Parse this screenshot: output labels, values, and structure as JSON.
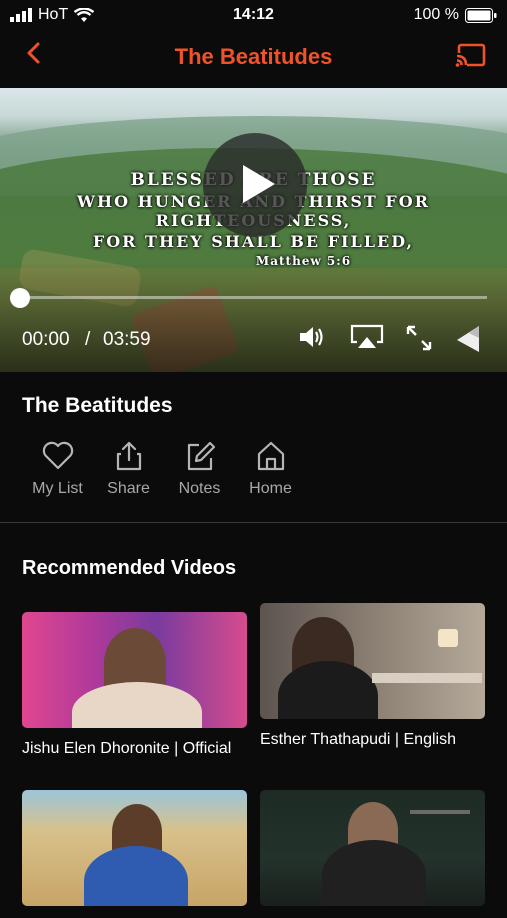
{
  "status_bar": {
    "carrier": "HoT",
    "time": "14:12",
    "battery": "100 %"
  },
  "nav": {
    "title": "The Beatitudes",
    "back_icon": "chevron-left-icon",
    "cast_icon": "cast-icon"
  },
  "player": {
    "overlay": {
      "line1": "BLESSED ARE THOSE",
      "line2": "WHO HUNGER AND THIRST FOR RIGHTEOUSNESS,",
      "line3": "FOR THEY SHALL BE FILLED,",
      "reference": "Matthew 5:6"
    },
    "current_time": "00:00",
    "separator": "/",
    "duration": "03:59",
    "progress": 0
  },
  "video": {
    "title": "The Beatitudes"
  },
  "actions": [
    {
      "label": "My List",
      "icon": "heart-icon"
    },
    {
      "label": "Share",
      "icon": "share-icon"
    },
    {
      "label": "Notes",
      "icon": "edit-icon"
    },
    {
      "label": "Home",
      "icon": "home-icon"
    }
  ],
  "recommended": {
    "heading": "Recommended Videos",
    "items": [
      {
        "label": "Jishu Elen Dhoronite | Official"
      },
      {
        "label": "Esther Thathapudi | English"
      },
      {
        "label": ""
      },
      {
        "label": ""
      }
    ]
  },
  "colors": {
    "accent": "#f0532a",
    "background": "#0b0b0b",
    "muted": "#a8a8a8"
  }
}
